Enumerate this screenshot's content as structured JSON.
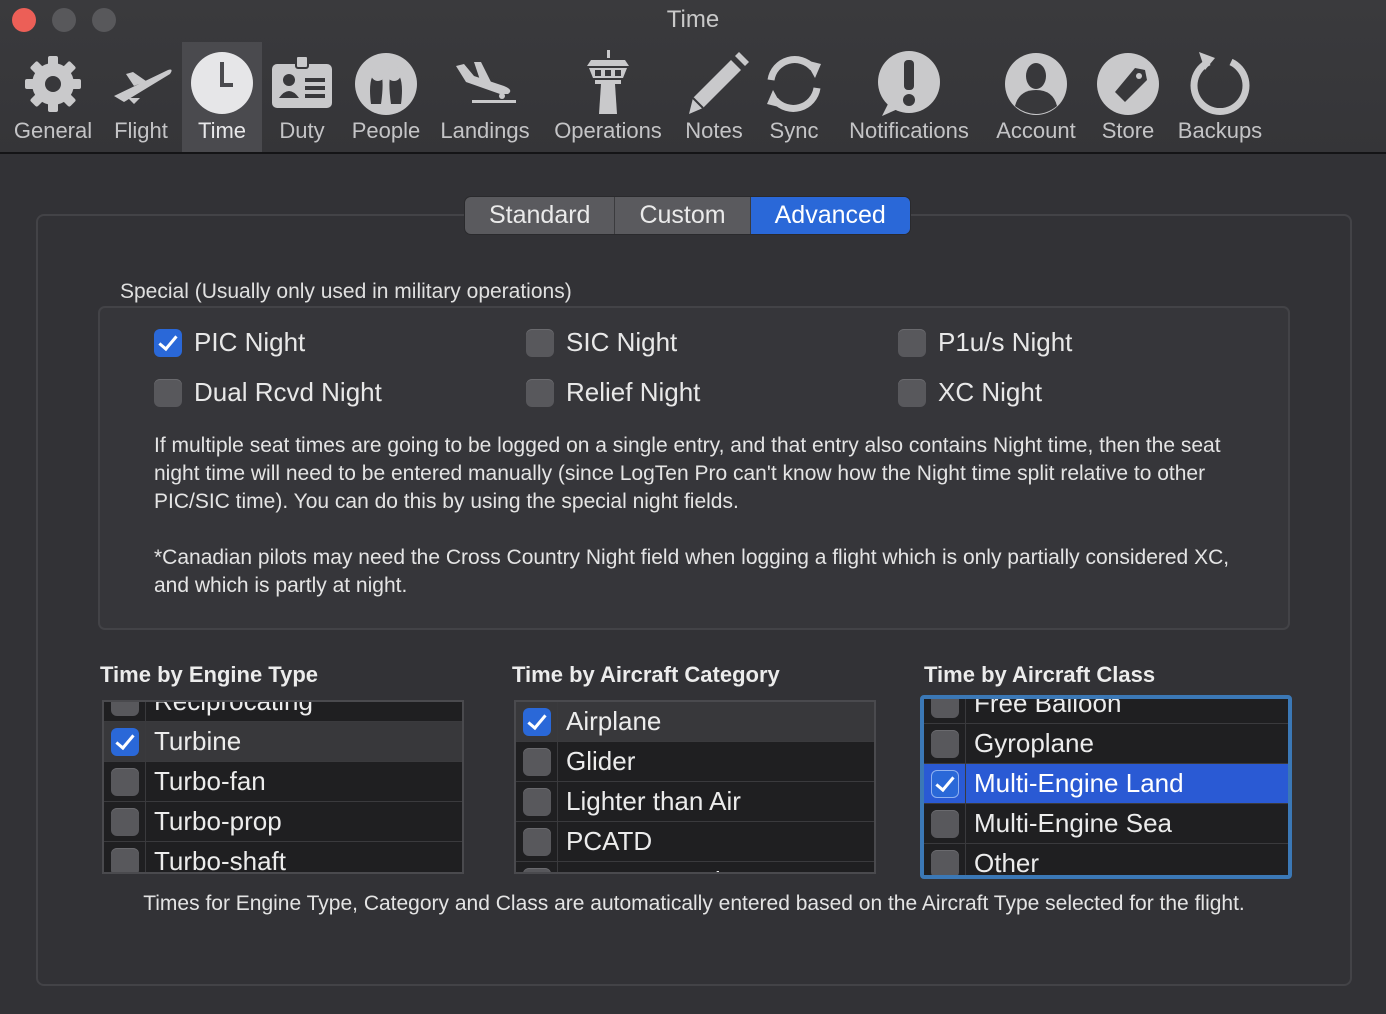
{
  "window": {
    "title": "Time"
  },
  "toolbar": {
    "items": [
      {
        "label": "General",
        "icon": "gear-icon"
      },
      {
        "label": "Flight",
        "icon": "airplane-icon"
      },
      {
        "label": "Time",
        "icon": "clock-icon"
      },
      {
        "label": "Duty",
        "icon": "id-card-icon"
      },
      {
        "label": "People",
        "icon": "people-icon"
      },
      {
        "label": "Landings",
        "icon": "landing-icon"
      },
      {
        "label": "Operations",
        "icon": "control-tower-icon"
      },
      {
        "label": "Notes",
        "icon": "pencil-icon"
      },
      {
        "label": "Sync",
        "icon": "sync-icon"
      },
      {
        "label": "Notifications",
        "icon": "exclamation-bubble-icon"
      },
      {
        "label": "Account",
        "icon": "person-silhouette-icon"
      },
      {
        "label": "Store",
        "icon": "tag-icon"
      },
      {
        "label": "Backups",
        "icon": "refresh-arrow-icon"
      }
    ],
    "selected": "Time"
  },
  "tabs": {
    "items": [
      "Standard",
      "Custom",
      "Advanced"
    ],
    "active": "Advanced"
  },
  "special": {
    "title": "Special (Usually only used in military operations)",
    "checkboxes": [
      {
        "label": "PIC Night",
        "checked": true
      },
      {
        "label": "SIC Night",
        "checked": false
      },
      {
        "label": "P1u/s Night",
        "checked": false
      },
      {
        "label": "Dual Rcvd Night",
        "checked": false
      },
      {
        "label": "Relief Night",
        "checked": false
      },
      {
        "label": "XC Night",
        "checked": false
      }
    ],
    "para1": "If multiple seat times are going to be logged on a single entry, and that entry also contains Night time, then the seat night time will need to be entered manually (since LogTen Pro can't know how the Night time split relative to other PIC/SIC time). You can do this by using the special night fields.",
    "para2": "*Canadian pilots may need the Cross Country Night field when logging a flight which is only partially considered XC, and which is partly at night."
  },
  "engine_type": {
    "title": "Time by Engine Type",
    "rows": [
      {
        "label": "Reciprocating",
        "checked": false
      },
      {
        "label": "Turbine",
        "checked": true
      },
      {
        "label": "Turbo-fan",
        "checked": false
      },
      {
        "label": "Turbo-prop",
        "checked": false
      },
      {
        "label": "Turbo-shaft",
        "checked": false
      }
    ]
  },
  "aircraft_category": {
    "title": "Time by Aircraft Category",
    "rows": [
      {
        "label": "Airplane",
        "checked": true
      },
      {
        "label": "Glider",
        "checked": false
      },
      {
        "label": "Lighter than Air",
        "checked": false
      },
      {
        "label": "PCATD",
        "checked": false
      },
      {
        "label": "Power Parachute",
        "checked": false
      }
    ]
  },
  "aircraft_class": {
    "title": "Time by Aircraft Class",
    "rows": [
      {
        "label": "Free Balloon",
        "checked": false
      },
      {
        "label": "Gyroplane",
        "checked": false
      },
      {
        "label": "Multi-Engine Land",
        "checked": true
      },
      {
        "label": "Multi-Engine Sea",
        "checked": false
      },
      {
        "label": "Other",
        "checked": false
      }
    ]
  },
  "footer": "Times for Engine Type, Category and Class are automatically entered based on the Aircraft Type selected for the flight."
}
